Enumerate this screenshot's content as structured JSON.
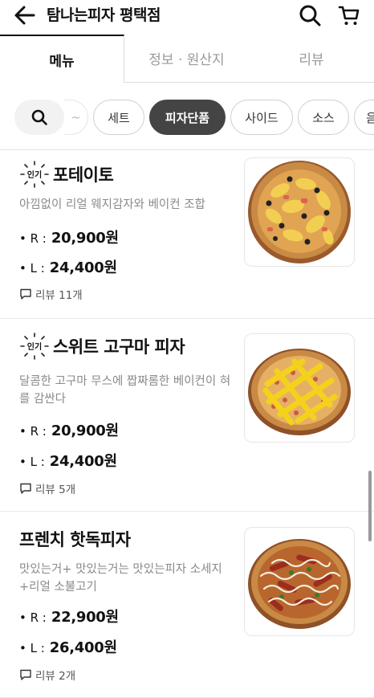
{
  "header": {
    "title": "탐나는피자 평택점",
    "back_icon": "arrow-left-icon",
    "search_icon": "search-icon",
    "cart_icon": "cart-icon"
  },
  "tabs": [
    {
      "label": "메뉴",
      "active": true
    },
    {
      "label": "정보 · 원산지",
      "active": false
    },
    {
      "label": "리뷰",
      "active": false
    }
  ],
  "categories": {
    "search_icon": "search-icon",
    "partial_left": "~",
    "items": [
      "세트",
      "피자단품",
      "사이드",
      "소스",
      "음"
    ],
    "selected": "피자단품"
  },
  "menu_items": [
    {
      "name": "포테이토",
      "popular_badge": "인기",
      "description": "아낌없이 리얼 웨지감자와 베이컨 조합",
      "prices": [
        {
          "label": "• R :",
          "value": "20,900원"
        },
        {
          "label": "• L :",
          "value": "24,400원"
        }
      ],
      "review": "리뷰 11개"
    },
    {
      "name": "스위트 고구마 피자",
      "popular_badge": "인기",
      "description": "달콤한 고구마 무스에 짭짜롬한 베이컨이 혀를 감싼다",
      "prices": [
        {
          "label": "• R :",
          "value": "20,900원"
        },
        {
          "label": "• L :",
          "value": "24,400원"
        }
      ],
      "review": "리뷰 5개"
    },
    {
      "name": "프렌치 핫독피자",
      "description": "맛있는거+ 맛있는거는 맛있는피자 소세지+리얼 소불고기",
      "prices": [
        {
          "label": "• R :",
          "value": "22,900원"
        },
        {
          "label": "• L :",
          "value": "26,400원"
        }
      ],
      "review": "리뷰 2개"
    }
  ],
  "colors": {
    "accent_chip": "#444444",
    "divider": "#e3e3e3",
    "muted_text": "#8a8a8a"
  }
}
